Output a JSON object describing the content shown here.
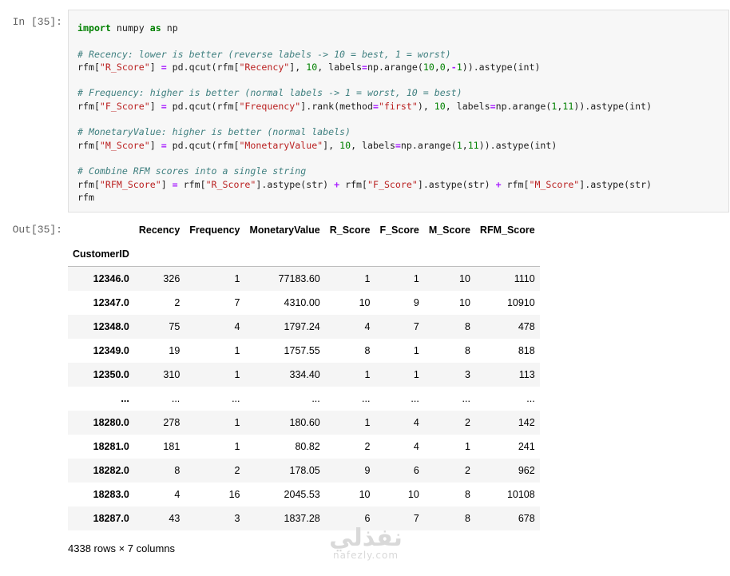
{
  "cell": {
    "in_prompt": "In [35]:",
    "out_prompt": "Out[35]:",
    "code_lines": [
      [
        [
          "kw",
          "import"
        ],
        [
          "t",
          " numpy "
        ],
        [
          "kw",
          "as"
        ],
        [
          "t",
          " np"
        ]
      ],
      [],
      [
        [
          "cm",
          "# Recency: lower is better (reverse labels -> 10 = best, 1 = worst)"
        ]
      ],
      [
        [
          "t",
          "rfm["
        ],
        [
          "st",
          "\"R_Score\""
        ],
        [
          "t",
          "] "
        ],
        [
          "op",
          "="
        ],
        [
          "t",
          " pd.qcut(rfm["
        ],
        [
          "st",
          "\"Recency\""
        ],
        [
          "t",
          "], "
        ],
        [
          "nu",
          "10"
        ],
        [
          "t",
          ", labels"
        ],
        [
          "op",
          "="
        ],
        [
          "t",
          "np.arange("
        ],
        [
          "nu",
          "10"
        ],
        [
          "t",
          ","
        ],
        [
          "nu",
          "0"
        ],
        [
          "t",
          ","
        ],
        [
          "op",
          "-"
        ],
        [
          "nu",
          "1"
        ],
        [
          "t",
          ")).astype(int)"
        ]
      ],
      [],
      [
        [
          "cm",
          "# Frequency: higher is better (normal labels -> 1 = worst, 10 = best)"
        ]
      ],
      [
        [
          "t",
          "rfm["
        ],
        [
          "st",
          "\"F_Score\""
        ],
        [
          "t",
          "] "
        ],
        [
          "op",
          "="
        ],
        [
          "t",
          " pd.qcut(rfm["
        ],
        [
          "st",
          "\"Frequency\""
        ],
        [
          "t",
          "].rank(method"
        ],
        [
          "op",
          "="
        ],
        [
          "st",
          "\"first\""
        ],
        [
          "t",
          "), "
        ],
        [
          "nu",
          "10"
        ],
        [
          "t",
          ", labels"
        ],
        [
          "op",
          "="
        ],
        [
          "t",
          "np.arange("
        ],
        [
          "nu",
          "1"
        ],
        [
          "t",
          ","
        ],
        [
          "nu",
          "11"
        ],
        [
          "t",
          ")).astype(int)"
        ]
      ],
      [],
      [
        [
          "cm",
          "# MonetaryValue: higher is better (normal labels)"
        ]
      ],
      [
        [
          "t",
          "rfm["
        ],
        [
          "st",
          "\"M_Score\""
        ],
        [
          "t",
          "] "
        ],
        [
          "op",
          "="
        ],
        [
          "t",
          " pd.qcut(rfm["
        ],
        [
          "st",
          "\"MonetaryValue\""
        ],
        [
          "t",
          "], "
        ],
        [
          "nu",
          "10"
        ],
        [
          "t",
          ", labels"
        ],
        [
          "op",
          "="
        ],
        [
          "t",
          "np.arange("
        ],
        [
          "nu",
          "1"
        ],
        [
          "t",
          ","
        ],
        [
          "nu",
          "11"
        ],
        [
          "t",
          ")).astype(int)"
        ]
      ],
      [],
      [
        [
          "cm",
          "# Combine RFM scores into a single string"
        ]
      ],
      [
        [
          "t",
          "rfm["
        ],
        [
          "st",
          "\"RFM_Score\""
        ],
        [
          "t",
          "] "
        ],
        [
          "op",
          "="
        ],
        [
          "t",
          " rfm["
        ],
        [
          "st",
          "\"R_Score\""
        ],
        [
          "t",
          "].astype(str) "
        ],
        [
          "op",
          "+"
        ],
        [
          "t",
          " rfm["
        ],
        [
          "st",
          "\"F_Score\""
        ],
        [
          "t",
          "].astype(str) "
        ],
        [
          "op",
          "+"
        ],
        [
          "t",
          " rfm["
        ],
        [
          "st",
          "\"M_Score\""
        ],
        [
          "t",
          "].astype(str)"
        ]
      ],
      [
        [
          "t",
          "rfm"
        ]
      ]
    ]
  },
  "dataframe": {
    "columns": [
      "Recency",
      "Frequency",
      "MonetaryValue",
      "R_Score",
      "F_Score",
      "M_Score",
      "RFM_Score"
    ],
    "index_name": "CustomerID",
    "rows": [
      {
        "index": "12346.0",
        "values": [
          "326",
          "1",
          "77183.60",
          "1",
          "1",
          "10",
          "1110"
        ]
      },
      {
        "index": "12347.0",
        "values": [
          "2",
          "7",
          "4310.00",
          "10",
          "9",
          "10",
          "10910"
        ]
      },
      {
        "index": "12348.0",
        "values": [
          "75",
          "4",
          "1797.24",
          "4",
          "7",
          "8",
          "478"
        ]
      },
      {
        "index": "12349.0",
        "values": [
          "19",
          "1",
          "1757.55",
          "8",
          "1",
          "8",
          "818"
        ]
      },
      {
        "index": "12350.0",
        "values": [
          "310",
          "1",
          "334.40",
          "1",
          "1",
          "3",
          "113"
        ]
      },
      {
        "index": "...",
        "values": [
          "...",
          "...",
          "...",
          "...",
          "...",
          "...",
          "..."
        ]
      },
      {
        "index": "18280.0",
        "values": [
          "278",
          "1",
          "180.60",
          "1",
          "4",
          "2",
          "142"
        ]
      },
      {
        "index": "18281.0",
        "values": [
          "181",
          "1",
          "80.82",
          "2",
          "4",
          "1",
          "241"
        ]
      },
      {
        "index": "18282.0",
        "values": [
          "8",
          "2",
          "178.05",
          "9",
          "6",
          "2",
          "962"
        ]
      },
      {
        "index": "18283.0",
        "values": [
          "4",
          "16",
          "2045.53",
          "10",
          "10",
          "8",
          "10108"
        ]
      },
      {
        "index": "18287.0",
        "values": [
          "43",
          "3",
          "1837.28",
          "6",
          "7",
          "8",
          "678"
        ]
      }
    ],
    "summary": "4338 rows × 7 columns"
  },
  "watermark": {
    "arabic": "نفذلي",
    "latin": "nafezly.com"
  }
}
